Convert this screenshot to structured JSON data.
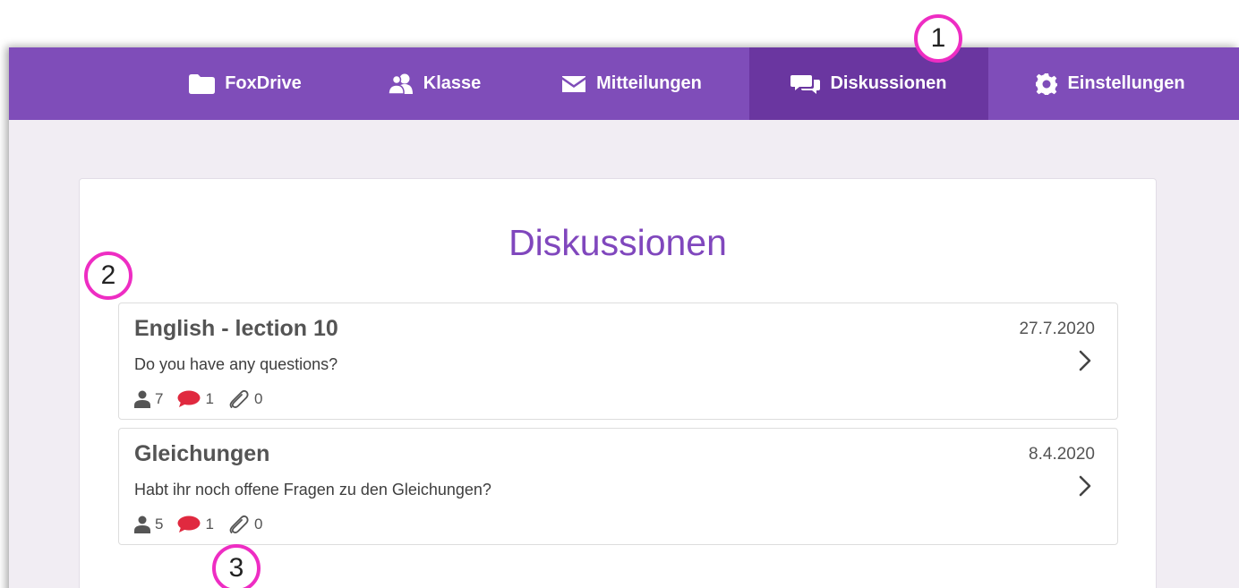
{
  "nav": {
    "items": [
      {
        "label": "FoxDrive",
        "icon": "folder-icon"
      },
      {
        "label": "Klasse",
        "icon": "users-icon"
      },
      {
        "label": "Mitteilungen",
        "icon": "envelope-icon"
      },
      {
        "label": "Diskussionen",
        "icon": "chat-bubbles-icon",
        "active": true
      },
      {
        "label": "Einstellungen",
        "icon": "gear-icon"
      }
    ]
  },
  "page": {
    "title": "Diskussionen"
  },
  "discussions": [
    {
      "title": "English - lection 10",
      "date": "27.7.2020",
      "description": "Do you have any questions?",
      "participants": "7",
      "comments": "1",
      "attachments": "0"
    },
    {
      "title": "Gleichungen",
      "date": "8.4.2020",
      "description": "Habt ihr noch offene Fragen zu den Gleichungen?",
      "participants": "5",
      "comments": "1",
      "attachments": "0"
    }
  ],
  "callouts": [
    "1",
    "2",
    "3"
  ],
  "colors": {
    "navbar": "#7f4db9",
    "navbar_active": "#6a36a0",
    "title": "#8047bd",
    "comment_icon": "#e0293f",
    "callout_ring": "#ee2dc3",
    "background": "#f1edf3"
  }
}
